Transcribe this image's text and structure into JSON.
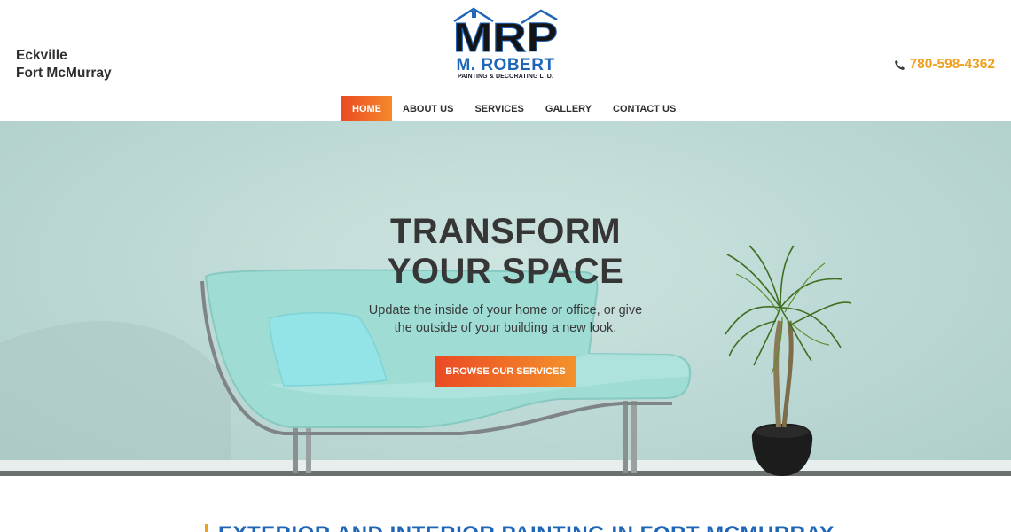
{
  "header": {
    "locations": [
      "Eckville",
      "Fort McMurray"
    ],
    "phone": "780-598-4362",
    "logo": {
      "monogram": "MRP",
      "name": "M. ROBERT",
      "tagline": "PAINTING & DECORATING LTD."
    }
  },
  "nav": {
    "items": [
      {
        "label": "HOME",
        "active": true
      },
      {
        "label": "ABOUT US",
        "active": false
      },
      {
        "label": "SERVICES",
        "active": false
      },
      {
        "label": "GALLERY",
        "active": false
      },
      {
        "label": "CONTACT US",
        "active": false
      }
    ]
  },
  "hero": {
    "title_line1": "TRANSFORM",
    "title_line2": "YOUR SPACE",
    "subtitle_line1": "Update the inside of your home or office, or give",
    "subtitle_line2": "the outside of your building a new look.",
    "button": "BROWSE OUR SERVICES"
  },
  "section": {
    "heading": "EXTERIOR AND INTERIOR PAINTING IN FORT MCMURRAY"
  },
  "colors": {
    "accent_orange": "#f0a020",
    "button_gradient_start": "#ea4a24",
    "button_gradient_end": "#f58a2a",
    "brand_blue": "#1f66b8",
    "hero_wall": "#bcd8d4"
  }
}
